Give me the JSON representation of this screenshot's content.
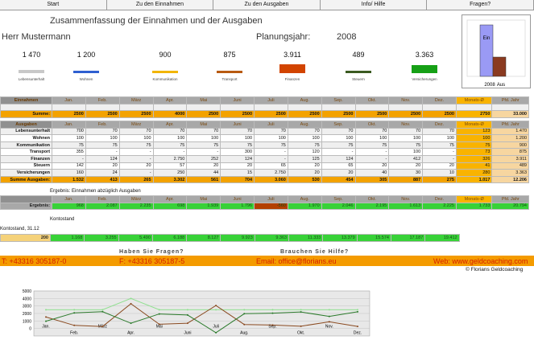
{
  "nav": [
    "Start",
    "Zu den Einnahmen",
    "Zu den Ausgaben",
    "Info/ Hilfe",
    "Fragen?"
  ],
  "title": "Zusammenfassung der Einnahmen und der Ausgaben",
  "person": "Herr Mustermann",
  "plan_label": "Planungsjahr:",
  "plan_year": "2008",
  "summary": [
    {
      "v": "1 470",
      "c": "Lebensunterhalt",
      "color": "#c8c8c8",
      "frac": 0.2
    },
    {
      "v": "1 200",
      "c": "Wohnen",
      "color": "#2f5fd0",
      "frac": 0.17
    },
    {
      "v": "900",
      "c": "Kommunikation",
      "color": "#f2b500",
      "frac": 0.13
    },
    {
      "v": "875",
      "c": "Transport",
      "color": "#b85a10",
      "frac": 0.12
    },
    {
      "v": "3.911",
      "c": "Finanzen",
      "color": "#d24400",
      "frac": 0.62
    },
    {
      "v": "489",
      "c": "Steuern",
      "color": "#3a5a20",
      "frac": 0.06
    },
    {
      "v": "3.363",
      "c": "Versicherungen",
      "color": "#16a016",
      "frac": 0.55
    }
  ],
  "mini": {
    "label_a": "Ein",
    "label_b": "Aus",
    "year": "2008"
  },
  "months": [
    "Jan.",
    "Feb.",
    "März",
    "Apr.",
    "Mai",
    "Juni",
    "Juli",
    "Aug.",
    "Sep.",
    "Okt.",
    "Nov.",
    "Dez."
  ],
  "einnahmen": {
    "head": "Einnahmen",
    "avg": "Monats-Ø",
    "year": "Pfd. Jahr",
    "sum_label": "Summe:",
    "sum": [
      "2500",
      "2500",
      "2500",
      "4000",
      "2500",
      "2500",
      "2500",
      "2500",
      "2500",
      "2500",
      "2500",
      "2500"
    ],
    "sum_avg": "2750",
    "sum_year": "33.000"
  },
  "ausgaben": {
    "head": "Ausgaben",
    "avg": "Monats-Ø",
    "year": "Pfd. Jahr",
    "rows": [
      {
        "l": "Lebensunterhalt",
        "v": [
          "700",
          "70",
          "70",
          "70",
          "70",
          "70",
          "70",
          "70",
          "70",
          "70",
          "70",
          "70"
        ],
        "a": "123",
        "y": "1.470"
      },
      {
        "l": "Wohnen",
        "v": [
          "100",
          "100",
          "100",
          "100",
          "100",
          "100",
          "100",
          "100",
          "100",
          "100",
          "100",
          "100"
        ],
        "a": "100",
        "y": "1.200"
      },
      {
        "l": "Kommunikation",
        "v": [
          "75",
          "75",
          "75",
          "75",
          "75",
          "75",
          "75",
          "75",
          "75",
          "75",
          "75",
          "75"
        ],
        "a": "75",
        "y": "900"
      },
      {
        "l": "Transport",
        "v": [
          "355",
          "-",
          "-",
          "-",
          "-",
          "300",
          "-",
          "120",
          "-",
          "-",
          "100",
          "-"
        ],
        "a": "73",
        "y": "875"
      },
      {
        "l": "Finanzen",
        "v": [
          "-",
          "124",
          "-",
          "2.750",
          "252",
          "124",
          "-",
          "125",
          "124",
          "-",
          "412",
          "-"
        ],
        "a": "326",
        "y": "3.911"
      },
      {
        "l": "Steuern",
        "v": [
          "142",
          "20",
          "20",
          "57",
          "20",
          "20",
          "65",
          "20",
          "65",
          "20",
          "20",
          "20"
        ],
        "a": "41",
        "y": "489"
      },
      {
        "l": "Versicherungen",
        "v": [
          "160",
          "24",
          "-",
          "250",
          "44",
          "15",
          "2.750",
          "20",
          "20",
          "40",
          "30",
          "10"
        ],
        "a": "280",
        "y": "3.363"
      }
    ],
    "sum_label": "Summe Ausgaben:",
    "sum": [
      "1.532",
      "413",
      "265",
      "3.302",
      "561",
      "704",
      "3.060",
      "530",
      "454",
      "305",
      "887",
      "275"
    ],
    "sum_avg": "1.017",
    "sum_year": "12.206"
  },
  "ergebnis": {
    "caption": "Ergebnis: Einnahmen abzüglich Ausgaben",
    "label": "Ergebnis:",
    "v": [
      "968",
      "2.087",
      "2.235",
      "698",
      "1.939",
      "1.796",
      "-560",
      "1.970",
      "2.046",
      "2.195",
      "1.613",
      "2.225"
    ],
    "avg": "1.733",
    "year": "20.794"
  },
  "kontostand": {
    "caption": "Kontostand",
    "label": "Kontostand, 31.12",
    "start": "200",
    "v": [
      "1.168",
      "3.255",
      "5.490",
      "6.188",
      "8.127",
      "9.923",
      "9.363",
      "11.333",
      "13.379",
      "15.574",
      "17.187",
      "19.412"
    ]
  },
  "contact": {
    "fragen": "Haben Sie Fragen?",
    "hilfe": "Brauchen Sie Hilfe?",
    "phone1": "T: +43316 305187-0",
    "phone2": "F: +43316 305187-5",
    "email": "Email: office@florians.eu",
    "web": "Web: www.geldcoaching.com",
    "copyright": "© Florians Geldcoaching"
  },
  "chart_data": {
    "type": "line",
    "ylim": [
      0,
      5000
    ],
    "yticks": [
      "5000",
      "4000",
      "3000",
      "2000",
      "1000",
      "0"
    ],
    "categories": [
      "Jan.",
      "Feb.",
      "März",
      "Apr.",
      "Mai",
      "Juni",
      "Juli",
      "Aug.",
      "Sep.",
      "Okt.",
      "Nov.",
      "Dez."
    ],
    "series": [
      {
        "name": "Einnahmen",
        "color": "#90e090",
        "values": [
          2500,
          2500,
          2500,
          4000,
          2500,
          2500,
          2500,
          2500,
          2500,
          2500,
          2500,
          2500
        ]
      },
      {
        "name": "Ausgaben",
        "color": "#8a4a20",
        "values": [
          1532,
          413,
          265,
          3302,
          561,
          704,
          3060,
          530,
          454,
          305,
          887,
          275
        ]
      },
      {
        "name": "Ergebnis",
        "color": "#2a7a2a",
        "values": [
          968,
          2087,
          2235,
          698,
          1939,
          1796,
          -560,
          1970,
          2046,
          2195,
          1613,
          2225
        ]
      }
    ]
  }
}
